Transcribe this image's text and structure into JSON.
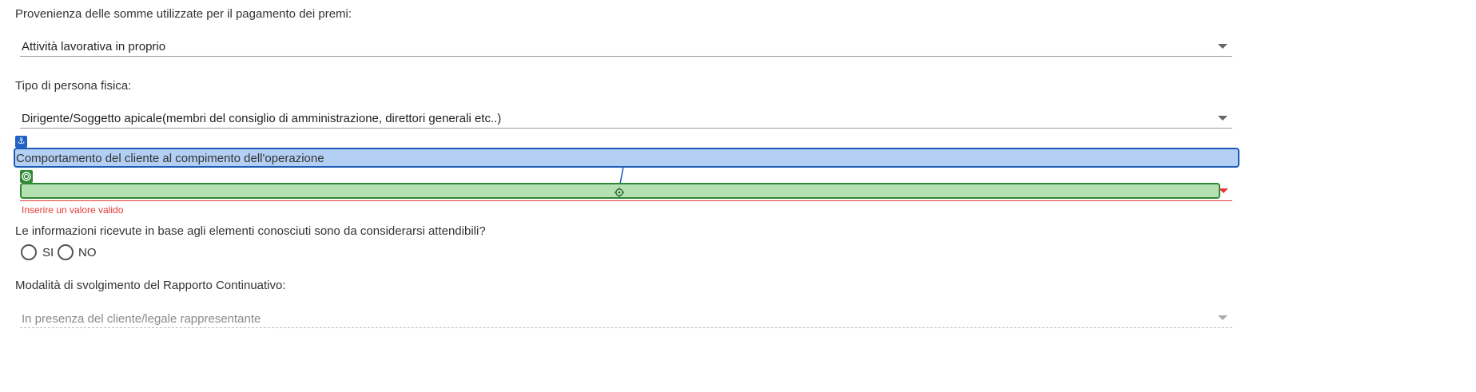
{
  "form": {
    "field1": {
      "label": "Provenienza delle somme utilizzate per il pagamento dei premi:",
      "value": "Attività lavorativa in proprio"
    },
    "field2": {
      "label": "Tipo di persona fisica:",
      "value": "Dirigente/Soggetto apicale(membri del consiglio di amministrazione, direttori generali etc..)"
    },
    "field3": {
      "label": "Comportamento del cliente al compimento dell'operazione",
      "value": "",
      "error": "Inserire un valore valido"
    },
    "question": {
      "label": "Le informazioni ricevute in base agli elementi conosciuti sono da considerarsi attendibili?",
      "options": [
        "SI",
        "NO"
      ]
    },
    "field5": {
      "label": "Modalità di svolgimento del Rapporto Continuativo:",
      "value": "In presenza del cliente/legale rappresentante"
    }
  },
  "colors": {
    "error": "#e53935",
    "anchor_highlight": "#b3cff3",
    "target_highlight": "#b5e0b1"
  },
  "icons": [
    "anchor-icon",
    "target-icon",
    "crosshair-icon",
    "caret-down-icon"
  ]
}
